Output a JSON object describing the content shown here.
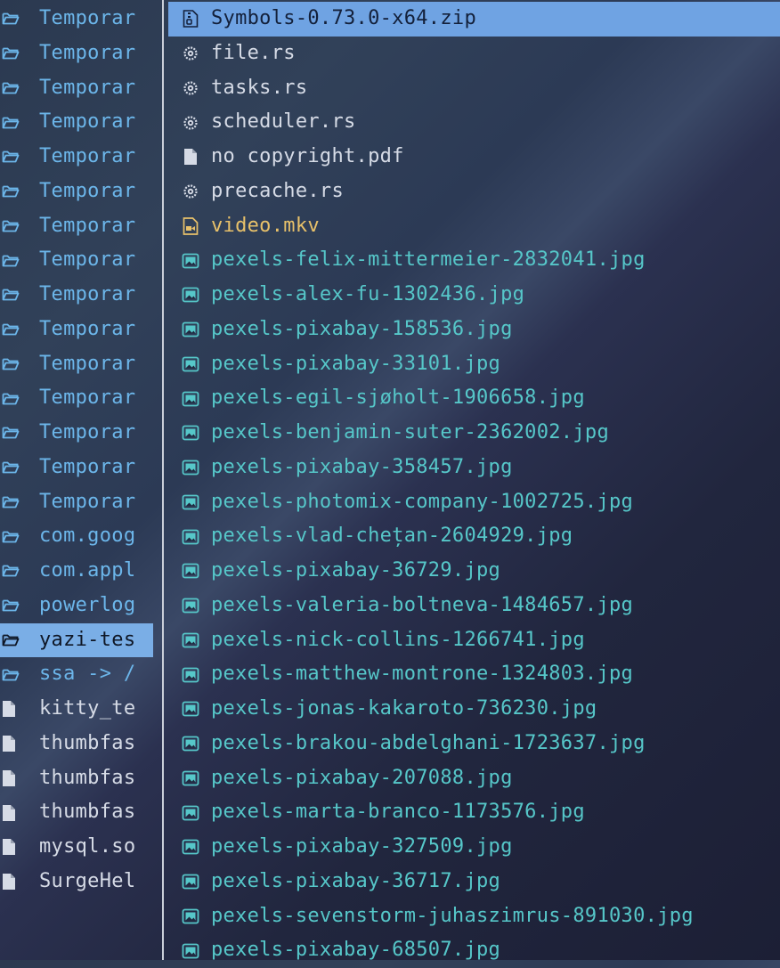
{
  "left_pane": {
    "items": [
      {
        "name": "Temporar",
        "type": "dir"
      },
      {
        "name": "Temporar",
        "type": "dir"
      },
      {
        "name": "Temporar",
        "type": "dir"
      },
      {
        "name": "Temporar",
        "type": "dir"
      },
      {
        "name": "Temporar",
        "type": "dir"
      },
      {
        "name": "Temporar",
        "type": "dir"
      },
      {
        "name": "Temporar",
        "type": "dir"
      },
      {
        "name": "Temporar",
        "type": "dir"
      },
      {
        "name": "Temporar",
        "type": "dir"
      },
      {
        "name": "Temporar",
        "type": "dir"
      },
      {
        "name": "Temporar",
        "type": "dir"
      },
      {
        "name": "Temporar",
        "type": "dir"
      },
      {
        "name": "Temporar",
        "type": "dir"
      },
      {
        "name": "Temporar",
        "type": "dir"
      },
      {
        "name": "Temporar",
        "type": "dir"
      },
      {
        "name": "com.goog",
        "type": "dir"
      },
      {
        "name": "com.appl",
        "type": "dir"
      },
      {
        "name": "powerlog",
        "type": "dir"
      },
      {
        "name": "yazi-tes",
        "type": "dir",
        "selected": true
      },
      {
        "name": "ssa -> /",
        "type": "dir"
      },
      {
        "name": "kitty_te",
        "type": "file"
      },
      {
        "name": "thumbfas",
        "type": "file"
      },
      {
        "name": "thumbfas",
        "type": "file"
      },
      {
        "name": "thumbfas",
        "type": "file"
      },
      {
        "name": "mysql.so",
        "type": "file"
      },
      {
        "name": "SurgeHel",
        "type": "file"
      }
    ]
  },
  "right_pane": {
    "items": [
      {
        "name": "Symbols-0.73.0-x64.zip",
        "type": "zip",
        "selected": true
      },
      {
        "name": "file.rs",
        "type": "rust"
      },
      {
        "name": "tasks.rs",
        "type": "rust"
      },
      {
        "name": "scheduler.rs",
        "type": "rust"
      },
      {
        "name": "no copyright.pdf",
        "type": "pdf"
      },
      {
        "name": "precache.rs",
        "type": "rust"
      },
      {
        "name": "video.mkv",
        "type": "video"
      },
      {
        "name": "pexels-felix-mittermeier-2832041.jpg",
        "type": "image"
      },
      {
        "name": "pexels-alex-fu-1302436.jpg",
        "type": "image"
      },
      {
        "name": "pexels-pixabay-158536.jpg",
        "type": "image"
      },
      {
        "name": "pexels-pixabay-33101.jpg",
        "type": "image"
      },
      {
        "name": "pexels-egil-sjøholt-1906658.jpg",
        "type": "image"
      },
      {
        "name": "pexels-benjamin-suter-2362002.jpg",
        "type": "image"
      },
      {
        "name": "pexels-pixabay-358457.jpg",
        "type": "image"
      },
      {
        "name": "pexels-photomix-company-1002725.jpg",
        "type": "image"
      },
      {
        "name": "pexels-vlad-chețan-2604929.jpg",
        "type": "image"
      },
      {
        "name": "pexels-pixabay-36729.jpg",
        "type": "image"
      },
      {
        "name": "pexels-valeria-boltneva-1484657.jpg",
        "type": "image"
      },
      {
        "name": "pexels-nick-collins-1266741.jpg",
        "type": "image"
      },
      {
        "name": "pexels-matthew-montrone-1324803.jpg",
        "type": "image"
      },
      {
        "name": "pexels-jonas-kakaroto-736230.jpg",
        "type": "image"
      },
      {
        "name": "pexels-brakou-abdelghani-1723637.jpg",
        "type": "image"
      },
      {
        "name": "pexels-pixabay-207088.jpg",
        "type": "image"
      },
      {
        "name": "pexels-marta-branco-1173576.jpg",
        "type": "image"
      },
      {
        "name": "pexels-pixabay-327509.jpg",
        "type": "image"
      },
      {
        "name": "pexels-pixabay-36717.jpg",
        "type": "image"
      },
      {
        "name": "pexels-sevenstorm-juhaszimrus-891030.jpg",
        "type": "image"
      },
      {
        "name": "pexels-pixabay-68507.jpg",
        "type": "image"
      }
    ]
  },
  "colors": {
    "directory": "#6cb6ea",
    "selection": "#7aaee6",
    "image": "#56c7c9",
    "video": "#e8c16a",
    "plain": "#d6dbe6"
  }
}
